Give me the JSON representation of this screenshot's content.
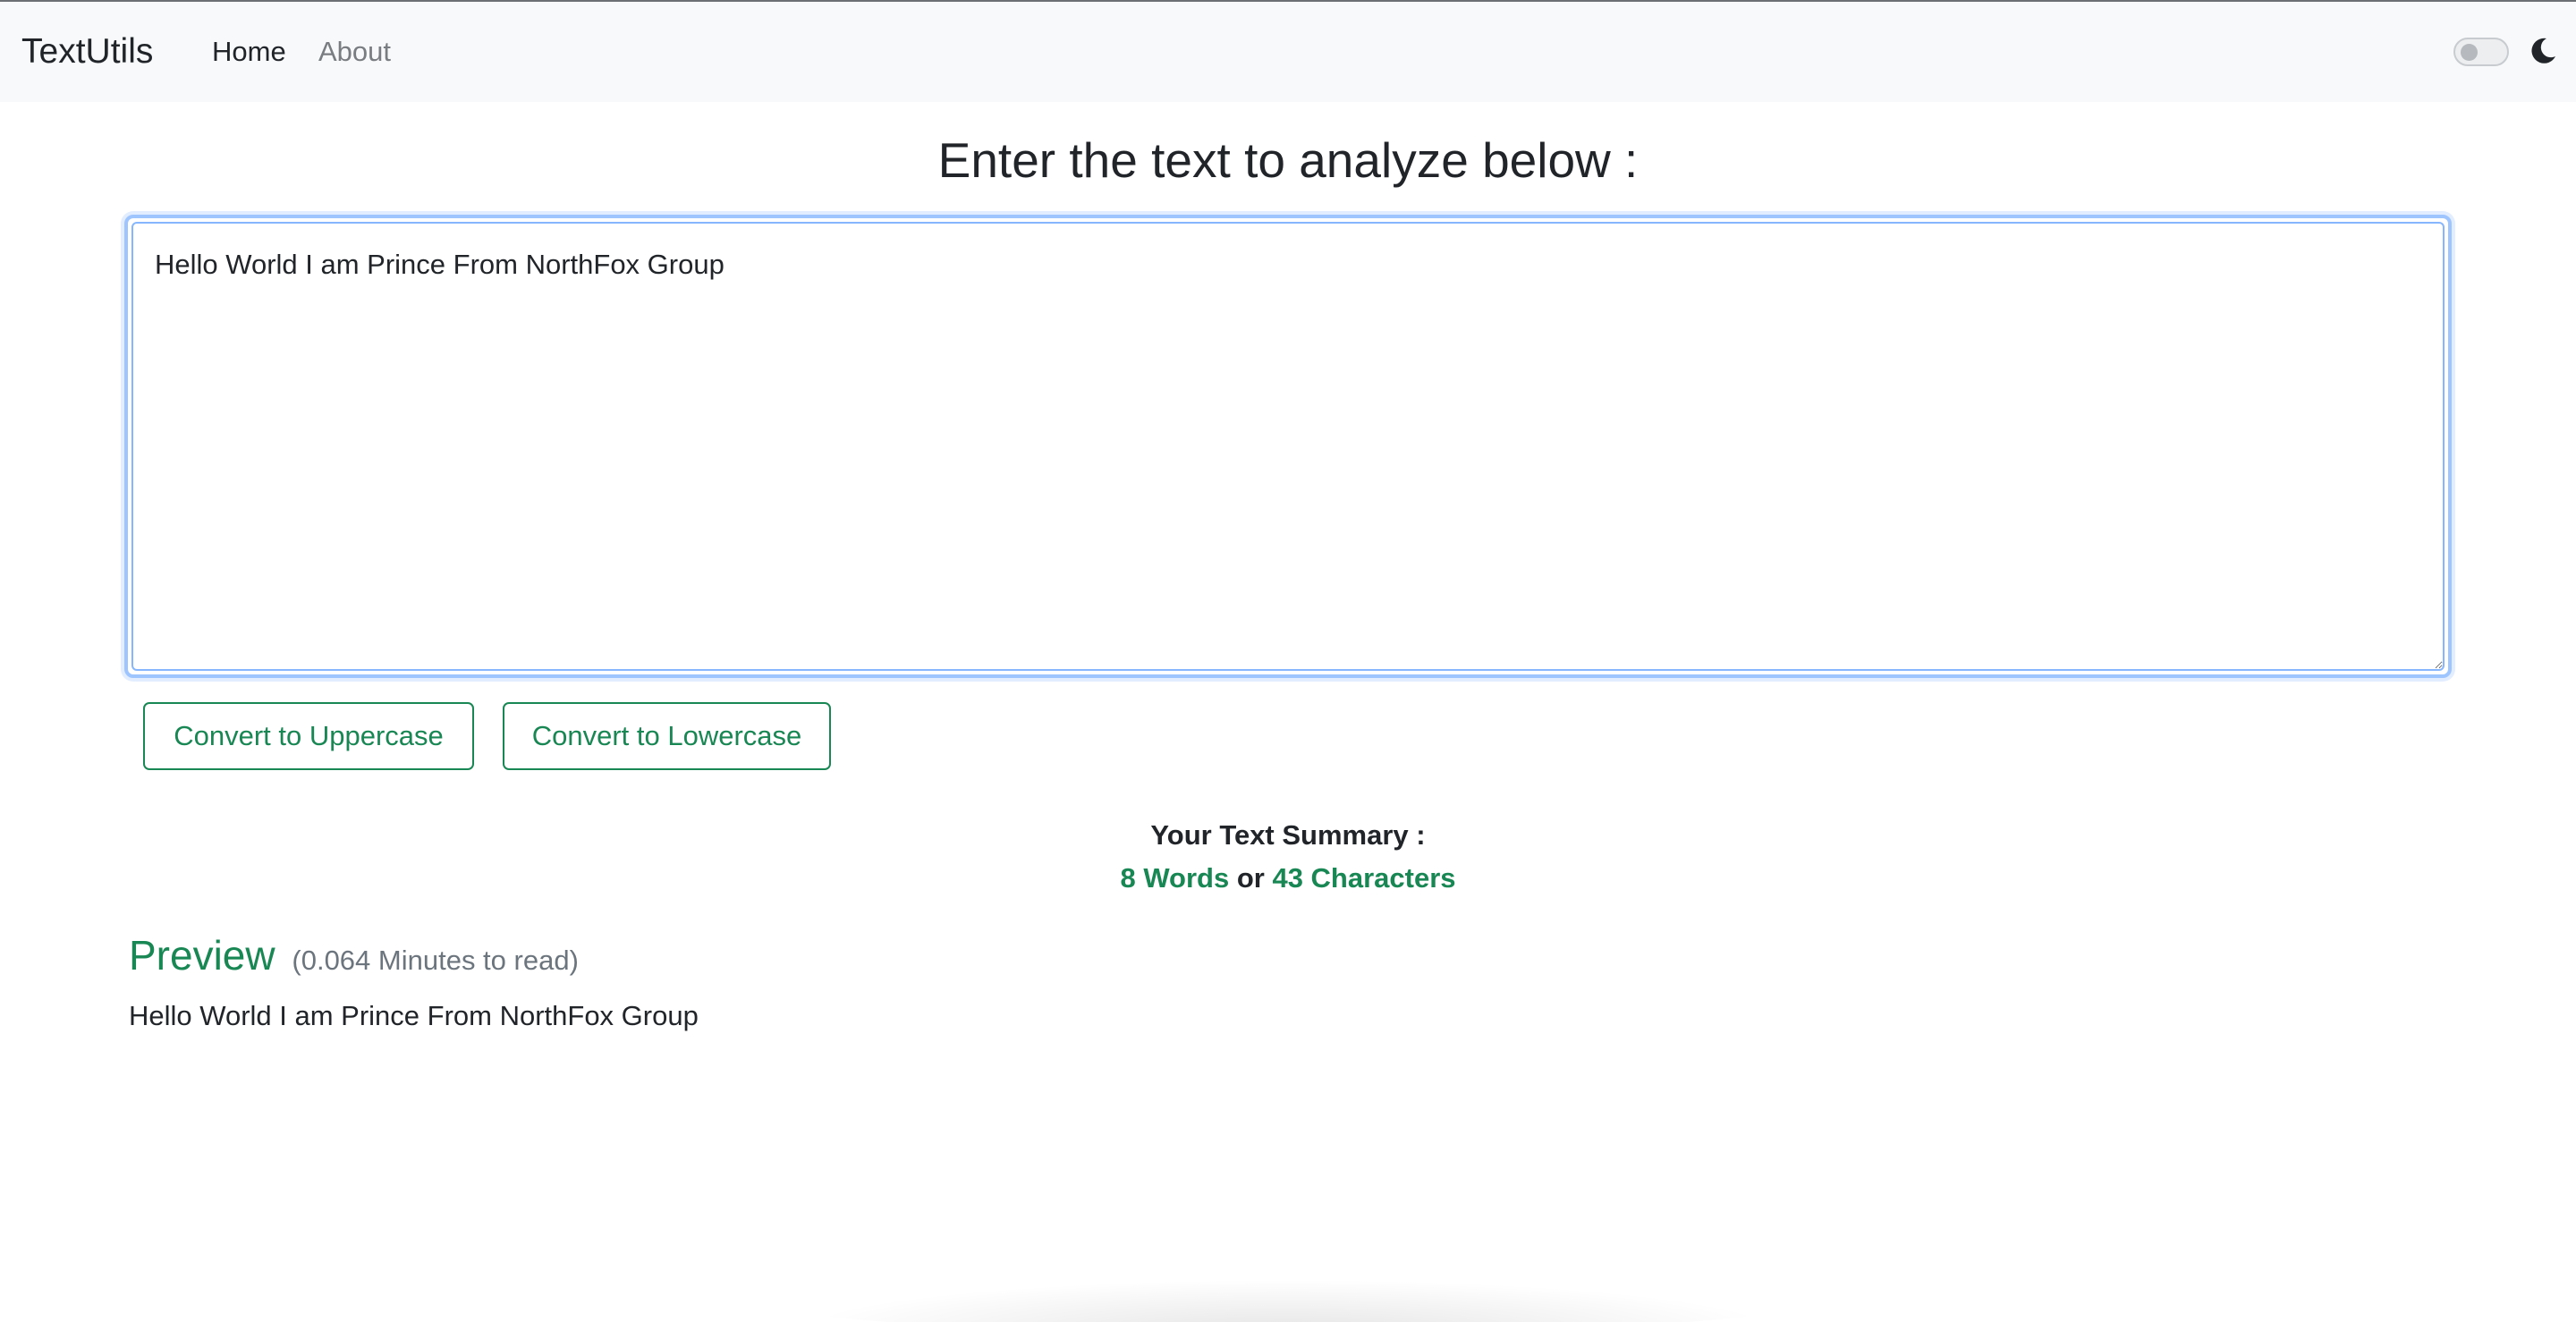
{
  "navbar": {
    "brand": "TextUtils",
    "links": [
      {
        "label": "Home"
      },
      {
        "label": "About"
      }
    ],
    "dark_mode_toggle": {
      "checked": false
    },
    "theme_icon": "moon-icon"
  },
  "main": {
    "heading": "Enter the text to analyze below :",
    "textarea_value": "Hello World I am Prince From NorthFox Group",
    "buttons": {
      "uppercase": "Convert to Uppercase",
      "lowercase": "Convert to Lowercase"
    },
    "summary": {
      "title": "Your Text Summary :",
      "words": "8 Words",
      "separator": "or",
      "characters": "43 Characters"
    },
    "preview": {
      "title": "Preview",
      "read_time": "(0.064 Minutes to read)",
      "text": "Hello World I am Prince From NorthFox Group"
    }
  },
  "colors": {
    "accent": "#198754",
    "focus_border": "#86b7fe",
    "navbar_bg": "#f8f9fa",
    "muted_text": "#6c757d"
  }
}
